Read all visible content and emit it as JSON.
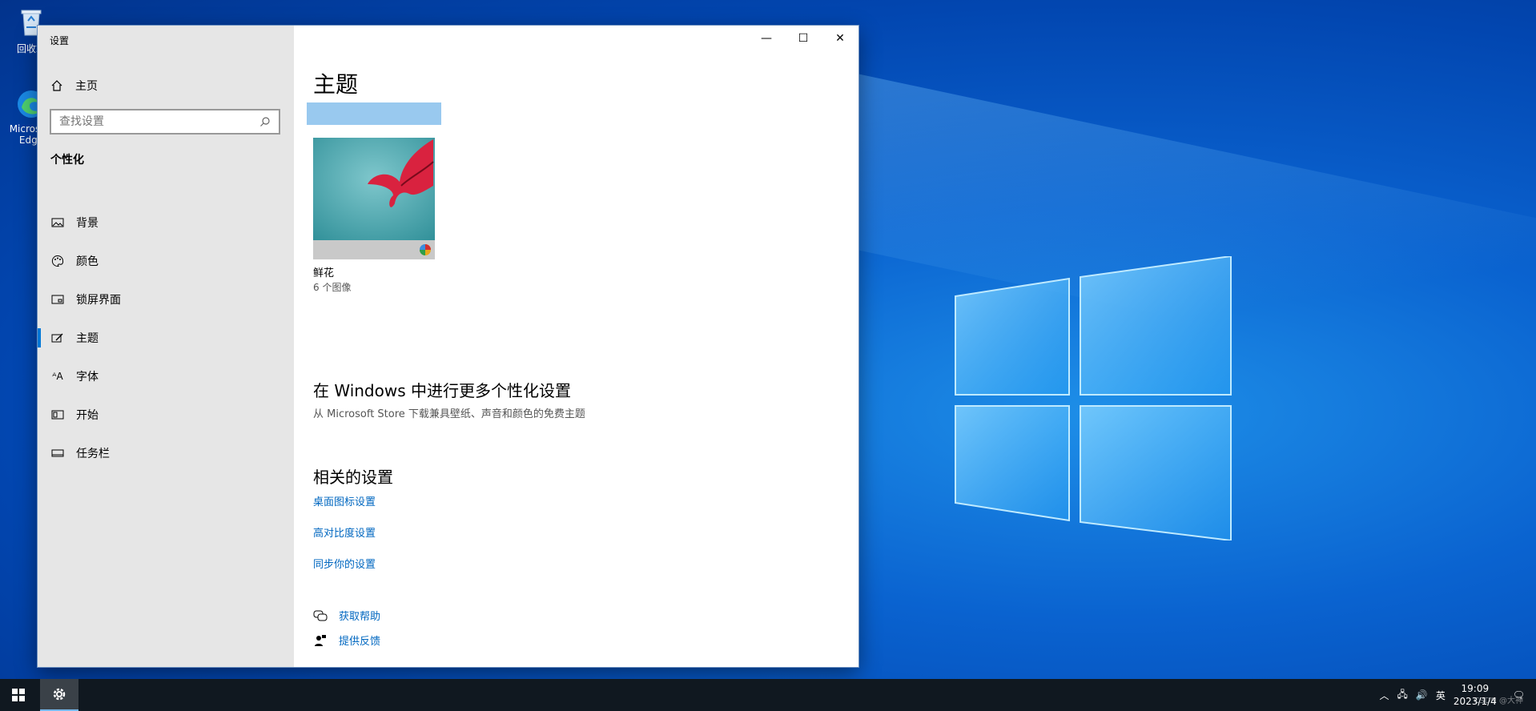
{
  "desktop": {
    "icons": [
      {
        "label": "回收站"
      },
      {
        "label": "Microsoft Edge"
      }
    ]
  },
  "window": {
    "title": "设置",
    "controls": {
      "minimize": "—",
      "maximize": "☐",
      "close": "✕"
    }
  },
  "sidebar": {
    "home_label": "主页",
    "search_placeholder": "查找设置",
    "section_heading": "个性化",
    "items": [
      {
        "label": "背景",
        "icon": "image-icon"
      },
      {
        "label": "颜色",
        "icon": "palette-icon"
      },
      {
        "label": "锁屏界面",
        "icon": "lock-screen-icon"
      },
      {
        "label": "主题",
        "icon": "theme-icon",
        "active": true
      },
      {
        "label": "字体",
        "icon": "font-icon"
      },
      {
        "label": "开始",
        "icon": "start-icon"
      },
      {
        "label": "任务栏",
        "icon": "taskbar-icon"
      }
    ]
  },
  "main": {
    "title": "主题",
    "theme": {
      "name": "鲜花",
      "count": "6 个图像"
    },
    "more": {
      "title": "在 Windows 中进行更多个性化设置",
      "description": "从 Microsoft Store 下载兼具壁纸、声音和颜色的免费主题"
    },
    "related": {
      "title": "相关的设置",
      "links": [
        "桌面图标设置",
        "高对比度设置",
        "同步你的设置"
      ]
    },
    "help": {
      "get_help": "获取帮助",
      "feedback": "提供反馈"
    }
  },
  "taskbar": {
    "ime": "英",
    "time": "19:09",
    "date": "2023/1/4",
    "watermark": "CSDN @大神"
  },
  "colors": {
    "accent": "#0078d7",
    "link": "#0067c0",
    "sidebar": "#e6e6e6"
  }
}
